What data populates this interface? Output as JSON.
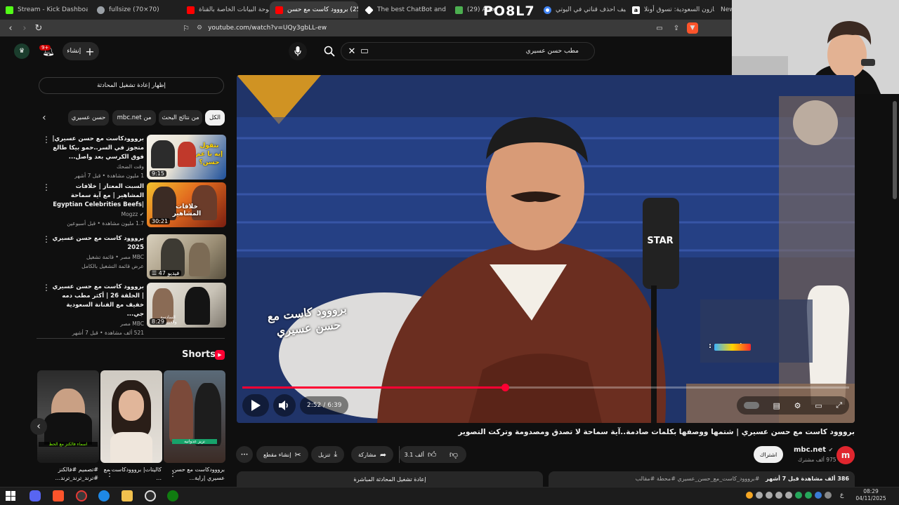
{
  "browser": {
    "tabs": [
      {
        "title": "Stream - Kick Dashboard",
        "color": "#53fc18"
      },
      {
        "title": "fullsize (70×70)",
        "color": "#9aa0a6"
      },
      {
        "title": "لوحة البيانات الخاصة بالقناة",
        "color": "#ff0000"
      },
      {
        "title": "(25) برووود كاست مع حسن",
        "color": "#ff0000"
      },
      {
        "title": "The best ChatBot and Wid",
        "color": "#ffffff"
      },
      {
        "title": "(29) Alex",
        "color": "#4caf50"
      },
      {
        "title": "كيف احذف قناتي في اليوتي",
        "color": "#4285f4"
      },
      {
        "title": "أمازون السعودية: تسوق أونلا",
        "color": "#ffffff"
      },
      {
        "title": "New t",
        "color": "#888888"
      }
    ],
    "overlay_text": "PO8L7",
    "url": "youtube.com/watch?v=UQy3gbLL-ew"
  },
  "header": {
    "search_value": "مطب حسن عسيري",
    "notification_count": "9+",
    "create_label": "إنشاء"
  },
  "sidebar": {
    "live_chat_label": "إظهار إعادة تشغيل المحادثة",
    "chips": [
      "الكل",
      "من نتائج البحث",
      "mbc.net من",
      "حسن عسيري"
    ],
    "recommendations": [
      {
        "title": "برووودكاست مع حسن عسيري| متجوز في السر..حمو بيكا طالع فوق الكرسي بعد واصل...",
        "channel": "وقت الضحك",
        "meta": "1 مليون مشاهدة • قبل 7 أشهر",
        "duration": "9:15",
        "thumb_text": "بتقول إيه يا عم حسن؟"
      },
      {
        "title": "السبت المعتاز | خلافات المشاهير | مع آية سماحة |Egyptian Celebrities Beefs",
        "channel": "Mogzz",
        "meta": "1.7 مليون مشاهدة • قبل أسبوعين",
        "duration": "30:21",
        "thumb_text": "خلافات المشاهير"
      },
      {
        "title": "برووود كاست مع حسن عسيري 2025",
        "channel": "MBC مصر • قائمة تشغيل",
        "meta": "عرض قائمة التشغيل بالكامل",
        "duration": "47 فيديو",
        "thumb_text": ""
      },
      {
        "title": "برووود كاست مع حسن عسيري | الحلقة 26 | أكثر مطب دمه خفيف مع الفنانة السعودية جي...",
        "channel": "MBC مصر",
        "meta": "521 ألف مشاهدة • قبل 7 أشهر",
        "duration": "8:29",
        "thumb_text": "السادسة والعشرون"
      }
    ],
    "shorts_label": "Shorts",
    "shorts": [
      {
        "title": "برووودكاست مع حسن عسيري |راية...",
        "banner": "نزيز عدوانيه"
      },
      {
        "title": "كاليتات| برووودكاست مع ...",
        "banner": ""
      },
      {
        "title": "#تصميم #فالكنز #ترند_ترند_ترند...",
        "banner": "اسماء فالكنز مع الحظ"
      }
    ]
  },
  "player": {
    "time_current": "2:52",
    "time_total": "6:39",
    "progress": 0.433,
    "watermark": "برووود كاست مع حسن عسيري",
    "mic_brand": "STAR",
    "gift_label": "مُستخفة :"
  },
  "video": {
    "title": "برووود كاست مع حسن عسيري | شتمها ووصفها بكلمات صادمة..آية سماحة لا تصدق ومصدومة وتركت التصوير",
    "channel_name": "mbc.net",
    "subscribers": "975 ألف مشترك",
    "subscribe_label": "اشتراك",
    "likes": "3.1 ألف",
    "share_label": "مشاركة",
    "download_label": "تنزيل",
    "clip_label": "إنشاء مقطع",
    "more_label": "•••",
    "description_meta": "386 ألف مشاهدة قبل 7 أشهر",
    "description_tags": "#برووود_كاست_مع_حسن_عسيري #محطة #مقالب",
    "live_chat_replay": "إعادة تشغيل المحادثة المباشرة"
  },
  "taskbar": {
    "time": "08:29",
    "date": "04/11/2025",
    "lang": "ع"
  }
}
